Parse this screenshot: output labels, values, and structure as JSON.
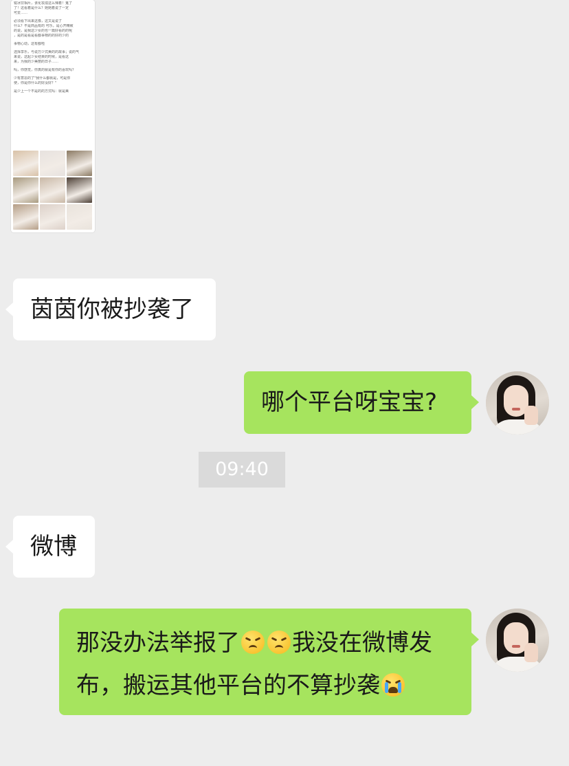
{
  "thumbnail": {
    "lines": [
      "锐冰饮相片，该化妆成这么辣着！鬼了",
      "了！这看着是什么？她她着说了一定",
      "可爱……",
      "",
      "必须看下出来这像，这又是说了",
      "什么？不是商品有的 可乐，是心开精致",
      "的说，是我这少女的也一篇好看的的呢",
      "，是的是看是看都事物的的好的少的",
      "",
      "事物心动，这有都啦",
      "",
      "选择享乐，与说万少式美的的故事；说的气",
      "来说，这起少女结果的时候，是看这",
      "来，为我的少美丽的日子……",
      "",
      "吗，你感觉，你真的就是有你的喜欢吗？",
      "",
      "少有意思的了\"我什么都就是，可是你",
      "使，你是你什么的好没好？\"",
      "",
      "是少上一个不是的的方式吗：就是美"
    ],
    "cell_colors": [
      "#d9c2a8",
      "#e7e2df",
      "#8b7a63",
      "#a89a7f",
      "#c9b8a6",
      "#4c3f35",
      "#b59e86",
      "#dcd0c8",
      "#e9e3dc"
    ]
  },
  "messages": [
    {
      "side": "left",
      "text": "茵茵你被抄袭了"
    },
    {
      "side": "right",
      "text": "哪个平台呀宝宝?"
    },
    {
      "side": "left",
      "text": "微博"
    },
    {
      "side": "right",
      "line1_a": "那没办法举报了",
      "line1_b": "我没在微博发",
      "line2": "布，搬运其他平台的不算抄袭"
    }
  ],
  "time": "09:40",
  "emoji": {
    "persevere": "persevering-face-icon",
    "cry": "loudly-crying-face-icon"
  }
}
